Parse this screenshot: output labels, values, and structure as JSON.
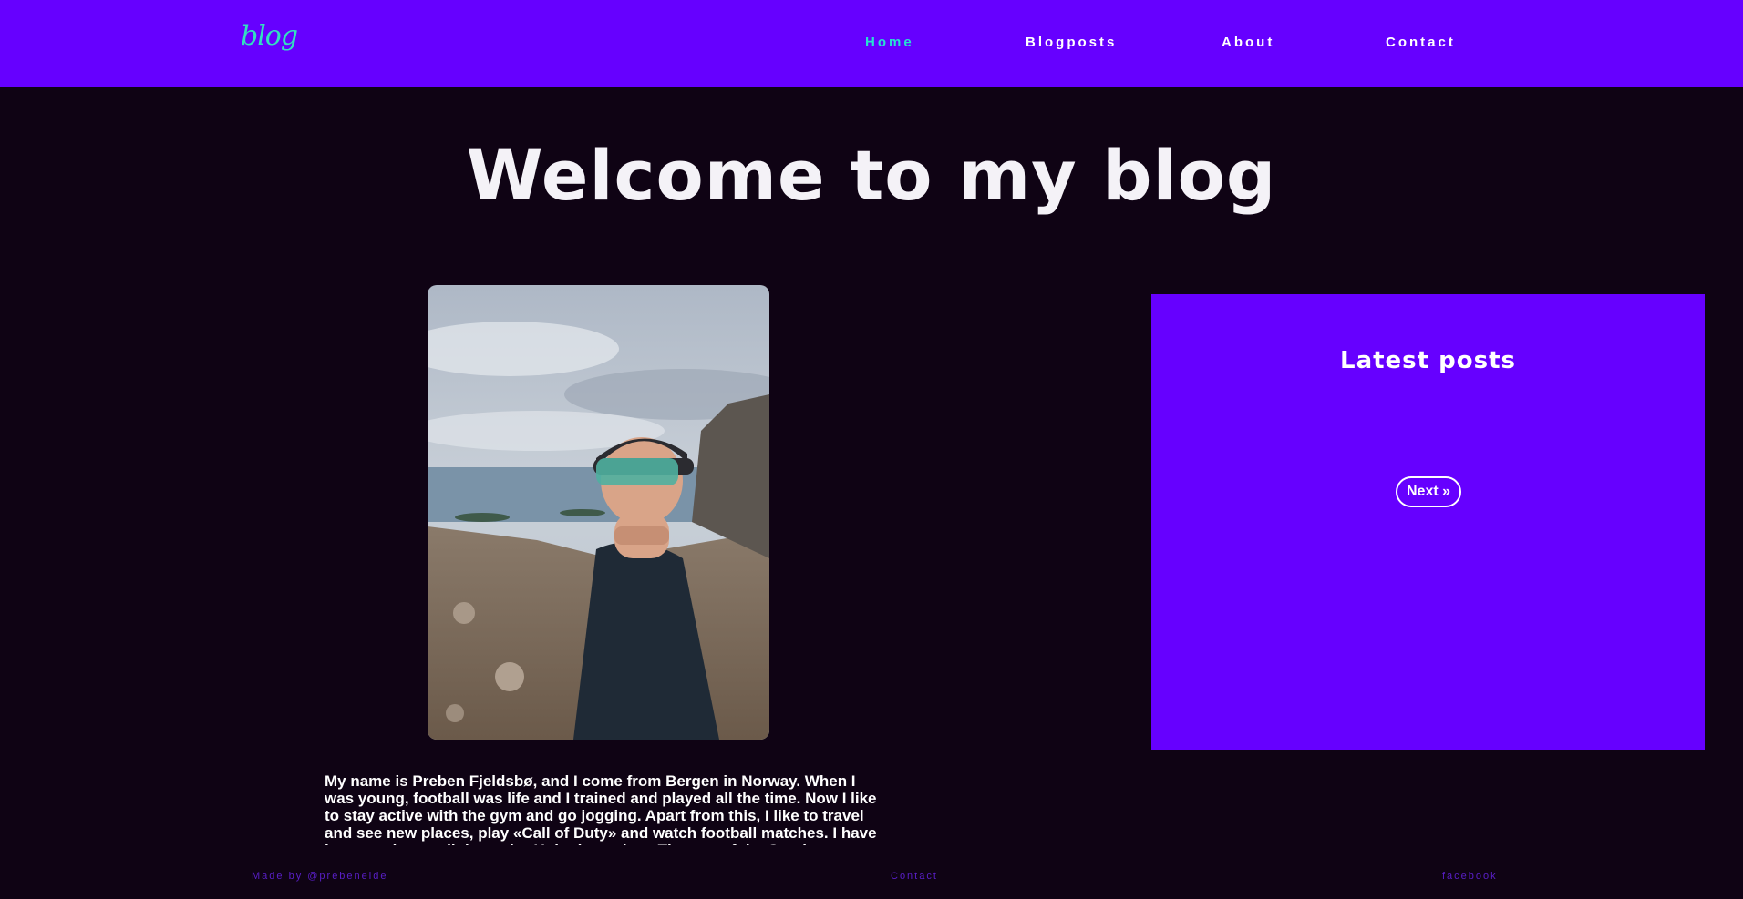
{
  "header": {
    "logo": "blog",
    "nav": [
      {
        "label": "Home",
        "active": true
      },
      {
        "label": "Blogposts",
        "active": false
      },
      {
        "label": "About",
        "active": false
      },
      {
        "label": "Contact",
        "active": false
      }
    ]
  },
  "hero": {
    "title": "Welcome to my blog"
  },
  "bio": {
    "text": "My name is Preben Fjeldsbø, and I come from Bergen in Norway. When I was young, football was life and I trained and played all the time. Now I like to stay active with the gym and go jogging. Apart from this, I like to travel and see new places, play «Call of Duty» and watch football matches. I have been to almost all the major United matches. The son of the South Stadium..."
  },
  "latest_posts": {
    "title": "Latest posts",
    "next_label": "Next »"
  },
  "footer": {
    "credit": "Made by @prebeneide",
    "contact": "Contact",
    "social": "facebook"
  },
  "colors": {
    "brand": "#6600ff",
    "background": "#0f0314",
    "accent": "#27e0d0"
  }
}
